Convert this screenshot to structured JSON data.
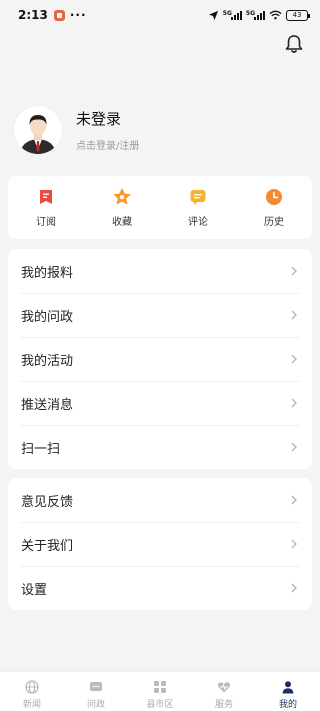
{
  "status_bar": {
    "time": "2:13",
    "dots": "···",
    "sig1": "5G",
    "sig2": "5G",
    "battery": "43"
  },
  "profile": {
    "name": "未登录",
    "subtitle": "点击登录/注册"
  },
  "quick_actions": [
    {
      "label": "订阅",
      "icon": "subscribe-icon",
      "color": "#e94b3c"
    },
    {
      "label": "收藏",
      "icon": "star-icon",
      "color": "#f39a2b"
    },
    {
      "label": "评论",
      "icon": "comment-icon",
      "color": "#f5b335"
    },
    {
      "label": "历史",
      "icon": "clock-icon",
      "color": "#f28a34"
    }
  ],
  "menu_group_1": [
    {
      "label": "我的报料"
    },
    {
      "label": "我的问政"
    },
    {
      "label": "我的活动"
    },
    {
      "label": "推送消息"
    },
    {
      "label": "扫一扫"
    }
  ],
  "menu_group_2": [
    {
      "label": "意见反馈"
    },
    {
      "label": "关于我们"
    },
    {
      "label": "设置"
    }
  ],
  "tabbar": [
    {
      "label": "新闻",
      "icon": "globe-icon"
    },
    {
      "label": "问政",
      "icon": "chat-icon"
    },
    {
      "label": "县市区",
      "icon": "grid-icon"
    },
    {
      "label": "服务",
      "icon": "heart-icon"
    },
    {
      "label": "我的",
      "icon": "person-icon",
      "active": true
    }
  ],
  "colors": {
    "accent": "#1c2f5c",
    "background": "#f4f4f4"
  }
}
